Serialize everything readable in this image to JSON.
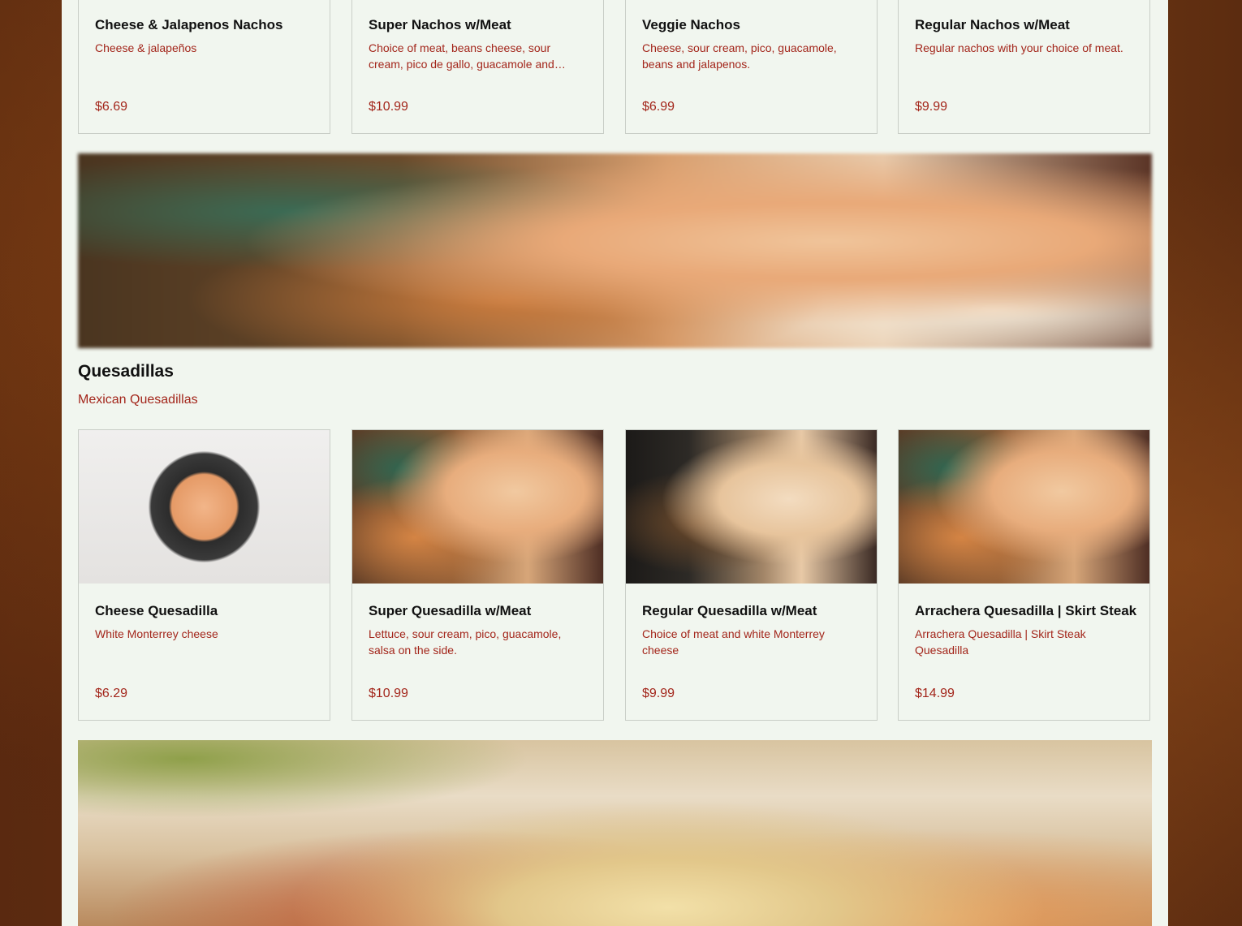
{
  "nachos_row": [
    {
      "name": "Cheese & Jalapenos Nachos",
      "desc": "Cheese & jalapeños",
      "price": "$6.69"
    },
    {
      "name": "Super Nachos w/Meat",
      "desc": "Choice of meat, beans cheese, sour cream, pico de gallo, guacamole and jalapeños.",
      "price": "$10.99"
    },
    {
      "name": "Veggie Nachos",
      "desc": "Cheese, sour cream, pico, guacamole, beans and jalapenos.",
      "price": "$6.99"
    },
    {
      "name": "Regular Nachos w/Meat",
      "desc": "Regular nachos with your choice of meat.",
      "price": "$9.99"
    }
  ],
  "quesadillas": {
    "title": "Quesadillas",
    "subtitle": "Mexican Quesadillas",
    "items": [
      {
        "name": "Cheese Quesadilla",
        "desc": "White Monterrey cheese",
        "price": "$6.29"
      },
      {
        "name": "Super Quesadilla w/Meat",
        "desc": "Lettuce, sour cream, pico, guacamole, salsa on the side.",
        "price": "$10.99"
      },
      {
        "name": "Regular Quesadilla w/Meat",
        "desc": "Choice of meat and white Monterrey cheese",
        "price": "$9.99"
      },
      {
        "name": "Arrachera Quesadilla | Skirt Steak",
        "desc": "Arrachera Quesadilla | Skirt Steak Quesadilla",
        "price": "$14.99"
      }
    ]
  },
  "colors": {
    "accent": "#a3261b",
    "panel": "#f1f6ef",
    "border": "#c9cec7"
  }
}
